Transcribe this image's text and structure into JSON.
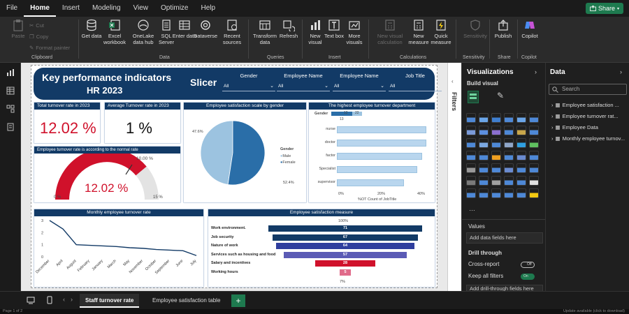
{
  "menu": [
    "File",
    "Home",
    "Insert",
    "Modeling",
    "View",
    "Optimize",
    "Help"
  ],
  "menu_active": "Home",
  "share_label": "Share",
  "ribbon": {
    "clipboard": {
      "paste": "Paste",
      "cut": "Cut",
      "copy": "Copy",
      "format_painter": "Format painter",
      "group": "Clipboard"
    },
    "data": {
      "items": [
        "Get data",
        "Excel workbook",
        "OneLake data hub",
        "SQL Server",
        "Enter data",
        "Dataverse",
        "Recent sources"
      ],
      "group": "Data"
    },
    "queries": {
      "items": [
        "Transform data",
        "Refresh"
      ],
      "group": "Queries"
    },
    "insert": {
      "items": [
        "New visual",
        "Text box",
        "More visuals"
      ],
      "group": "Insert"
    },
    "calculations": {
      "items": [
        "New visual calculation",
        "New measure",
        "Quick measure"
      ],
      "group": "Calculations"
    },
    "sensitivity": {
      "items": [
        "Sensitivity"
      ],
      "group": "Sensitivity"
    },
    "share": {
      "items": [
        "Publish"
      ],
      "group": "Share"
    },
    "copilot": {
      "items": [
        "Copilot"
      ],
      "group": "Copilot"
    }
  },
  "report": {
    "title_line1": "Key performance indicators",
    "title_line2": "HR 2023",
    "slicer_title": "Slicer",
    "slicers": [
      {
        "label": "Gender",
        "value": "All"
      },
      {
        "label": "Employee Name",
        "value": "All"
      },
      {
        "label": "Employee Name",
        "value": "All"
      },
      {
        "label": "Job Title",
        "value": "All"
      }
    ],
    "kpi1": {
      "title": "Total turnover rate in 2023",
      "value": "12.02 %"
    },
    "kpi2": {
      "title": "Average Turnover rate in 2023",
      "value": "1 %"
    },
    "gauge": {
      "title": "Employee turnover rate is according to the normal rate",
      "value": "12.02 %",
      "target_label": "10.00 %",
      "min_label": "0 %",
      "max_label": "15 %"
    },
    "pie": {
      "title": "Employee satisfaction scale by gender",
      "legend_title": "Gender",
      "slices": [
        {
          "name": "Male",
          "label": "47.6%"
        },
        {
          "name": "Female",
          "label": "52.4%"
        }
      ]
    },
    "dept": {
      "title": "The highest employee turnover department",
      "gender_label": "Gender",
      "gender_counts": [
        "12",
        "22"
      ],
      "gender_sub": "13",
      "categories": [
        "nurse",
        "doctor",
        "factor",
        "Specialist",
        "supervisor"
      ],
      "ticks": [
        "0%",
        "20%",
        "40%"
      ],
      "xlabel": "%OT Count of JobTitle"
    },
    "line": {
      "title": "Monthly employee turnover rate",
      "yticks": [
        "3",
        "2",
        "1",
        "0"
      ],
      "months": [
        "December",
        "April",
        "August",
        "February",
        "January",
        "March",
        "May",
        "November",
        "October",
        "September",
        "June",
        "July"
      ]
    },
    "funnel": {
      "title": "Employee satisfaction measure",
      "top_label": "100%",
      "bottom_label": "7%",
      "rows": [
        {
          "label": "Work environment.",
          "value": "71"
        },
        {
          "label": "Job security",
          "value": "67"
        },
        {
          "label": "Nature of work",
          "value": "64"
        },
        {
          "label": "Services such as housing and food",
          "value": "57"
        },
        {
          "label": "Salary and incentives",
          "value": "28"
        },
        {
          "label": "Working hours",
          "value": "5"
        }
      ]
    }
  },
  "chart_data": [
    {
      "type": "line",
      "title": "Monthly employee turnover rate",
      "x": [
        "December",
        "April",
        "August",
        "February",
        "January",
        "March",
        "May",
        "November",
        "October",
        "September",
        "June",
        "July"
      ],
      "values": [
        3,
        2.3,
        1,
        0.95,
        0.9,
        0.85,
        0.75,
        0.7,
        0.6,
        0.55,
        0.5,
        0.1
      ],
      "ylim": [
        0,
        3
      ]
    },
    {
      "type": "pie",
      "title": "Employee satisfaction scale by gender",
      "categories": [
        "Male",
        "Female"
      ],
      "values": [
        47.6,
        52.4
      ]
    },
    {
      "type": "bar",
      "title": "The highest employee turnover department",
      "categories": [
        "nurse",
        "doctor",
        "factor",
        "Specialist",
        "supervisor"
      ],
      "values": [
        42,
        40,
        38,
        36,
        30
      ],
      "xlabel": "%OT Count of JobTitle",
      "xlim": [
        0,
        40
      ]
    },
    {
      "type": "bar",
      "title": "Employee satisfaction measure",
      "categories": [
        "Work environment.",
        "Job security",
        "Nature of work",
        "Services such as housing and food",
        "Salary and incentives",
        "Working hours"
      ],
      "values": [
        71,
        67,
        64,
        57,
        28,
        5
      ]
    }
  ],
  "filters_label": "Filters",
  "viz_pane": {
    "title": "Visualizations",
    "build_visual": "Build visual",
    "values_label": "Values",
    "add_data": "Add data fields here",
    "drill_through": "Drill through",
    "cross_report": "Cross-report",
    "cross_report_toggle": "Off",
    "keep_filters": "Keep all filters",
    "keep_filters_toggle": "On",
    "add_drill": "Add drill-through fields here"
  },
  "data_pane": {
    "title": "Data",
    "search_placeholder": "Search",
    "tables": [
      "Employee satisfaction ...",
      "Employee turnover rat...",
      "Employee Data",
      "Monthly employee turnov..."
    ]
  },
  "tabs": [
    "Staff turnover rate",
    "Employee satisfaction table"
  ],
  "status": {
    "left": "Page 1 of 2",
    "right": "Update available (click to download)"
  },
  "colors": {
    "navy": "#123a66",
    "red": "#d0112b",
    "accent": "#1e7a4f"
  }
}
